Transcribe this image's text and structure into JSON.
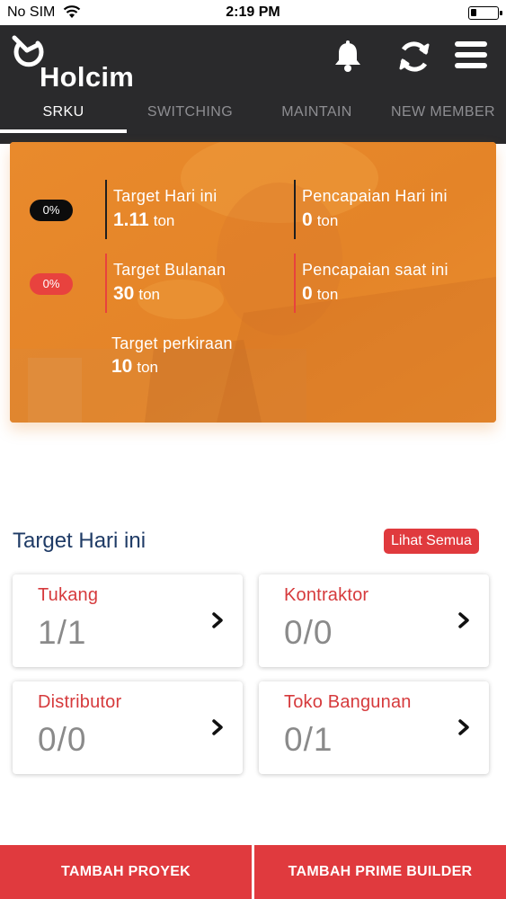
{
  "status_bar": {
    "carrier": "No SIM",
    "time": "2:19 PM"
  },
  "header": {
    "logo_text": "Holcim",
    "icons": {
      "notifications": "bell-icon",
      "sync": "sync-icon",
      "menu": "hamburger-menu-icon"
    },
    "tabs": [
      "SRKU",
      "SWITCHING",
      "MAINTAIN",
      "NEW MEMBER"
    ],
    "active_tab": "SRKU"
  },
  "summary": {
    "pills": [
      "0%",
      "0%"
    ],
    "target_today": {
      "label": "Target Hari ini",
      "value": "1.11",
      "unit": "ton"
    },
    "achievement_today": {
      "label": "Pencapaian Hari ini",
      "value": "0",
      "unit": "ton"
    },
    "target_monthly": {
      "label": "Target Bulanan",
      "value": "30",
      "unit": "ton"
    },
    "achievement_now": {
      "label": "Pencapaian saat ini",
      "value": "0",
      "unit": "ton"
    },
    "target_estimate": {
      "label": "Target perkiraan",
      "value": "10",
      "unit": "ton"
    }
  },
  "target_section": {
    "title": "Target Hari ini",
    "see_all": "Lihat Semua",
    "tiles": [
      {
        "label": "Tukang",
        "value": "1/1"
      },
      {
        "label": "Kontraktor",
        "value": "0/0"
      },
      {
        "label": "Distributor",
        "value": "0/0"
      },
      {
        "label": "Toko Bangunan",
        "value": "0/1"
      }
    ]
  },
  "actions": {
    "add_project": "TAMBAH PROYEK",
    "add_prime_builder": "TAMBAH PRIME BUILDER"
  },
  "colors": {
    "header_bg": "#2a2a2c",
    "accent_orange": "#e8892a",
    "accent_red": "#e03a3e",
    "title_blue": "#1f3b66"
  }
}
